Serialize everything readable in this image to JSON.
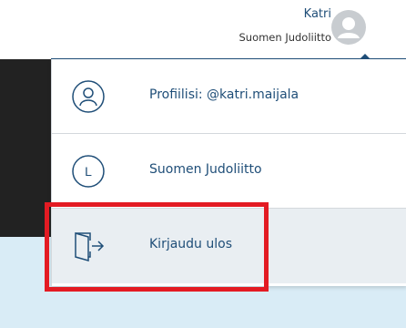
{
  "header": {
    "user_name": "Katri",
    "organization": "Suomen Judoliitto"
  },
  "menu": {
    "items": [
      {
        "label": "Profiilisi: @katri.maijala",
        "icon": "user-profile-icon"
      },
      {
        "label": "Suomen Judoliitto",
        "icon": "organization-letter-icon",
        "icon_letter": "L"
      },
      {
        "label": "Kirjaudu ulos",
        "icon": "logout-door-icon"
      }
    ]
  },
  "colors": {
    "brand_blue": "#1f4e78",
    "highlight_red": "#e31b23",
    "hover_bg": "#e9eef2",
    "page_light_blue": "#d9ecf6"
  }
}
